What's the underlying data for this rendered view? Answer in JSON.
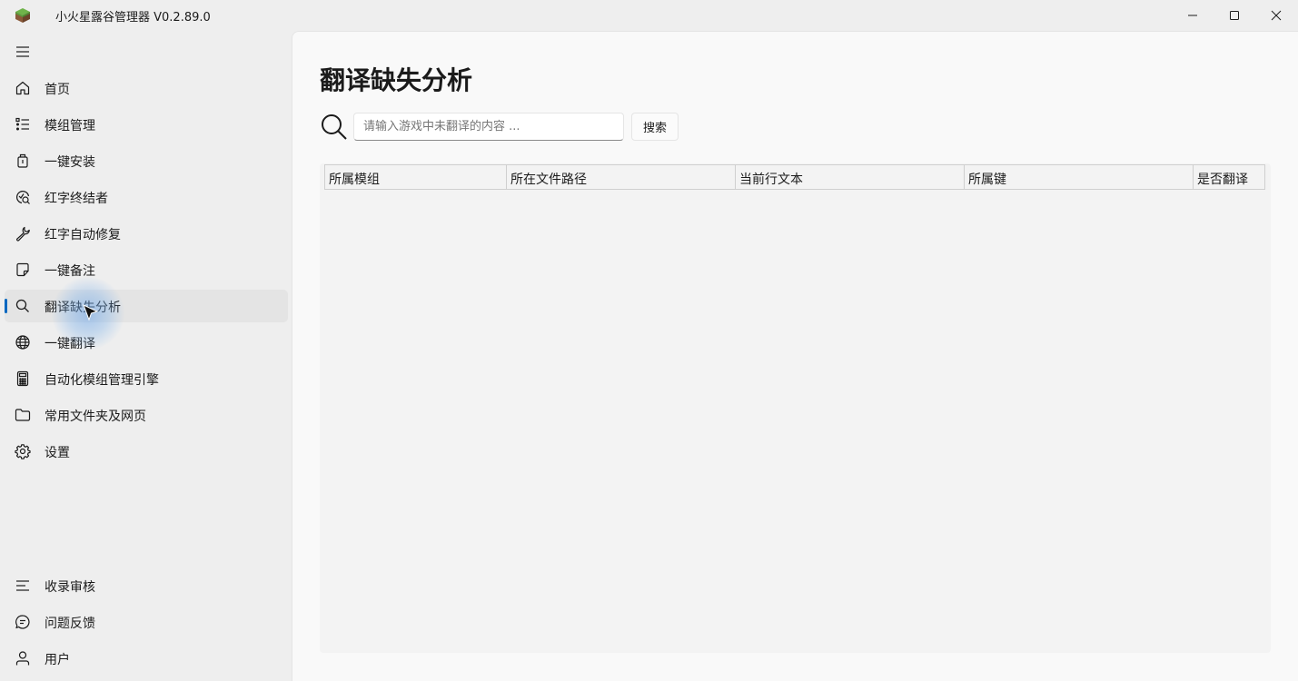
{
  "window": {
    "title": "小火星露谷管理器 V0.2.89.0",
    "minimize_icon": "minimize-icon",
    "maximize_icon": "maximize-icon",
    "close_icon": "close-icon"
  },
  "sidebar": {
    "menu_icon": "hamburger-menu-icon",
    "items": [
      {
        "label": "首页",
        "icon": "home-icon"
      },
      {
        "label": "模组管理",
        "icon": "list-icon"
      },
      {
        "label": "一键安装",
        "icon": "package-icon"
      },
      {
        "label": "红字终结者",
        "icon": "error-scan-icon"
      },
      {
        "label": "红字自动修复",
        "icon": "wrench-icon"
      },
      {
        "label": "一键备注",
        "icon": "note-icon"
      },
      {
        "label": "翻译缺失分析",
        "icon": "search-icon",
        "active": true
      },
      {
        "label": "一键翻译",
        "icon": "globe-icon"
      },
      {
        "label": "自动化模组管理引擎",
        "icon": "calculator-icon"
      },
      {
        "label": "常用文件夹及网页",
        "icon": "folder-icon"
      },
      {
        "label": "设置",
        "icon": "gear-icon"
      }
    ],
    "footer_items": [
      {
        "label": "收录审核",
        "icon": "review-list-icon"
      },
      {
        "label": "问题反馈",
        "icon": "chat-icon"
      },
      {
        "label": "用户",
        "icon": "user-icon"
      }
    ],
    "accent_color": "#0067c0"
  },
  "main": {
    "title": "翻译缺失分析",
    "search": {
      "placeholder": "请输入游戏中未翻译的内容 ...",
      "value": "",
      "button_label": "搜索"
    },
    "table": {
      "columns": [
        "所属模组",
        "所在文件路径",
        "当前行文本",
        "所属键",
        "是否翻译"
      ],
      "rows": []
    }
  }
}
